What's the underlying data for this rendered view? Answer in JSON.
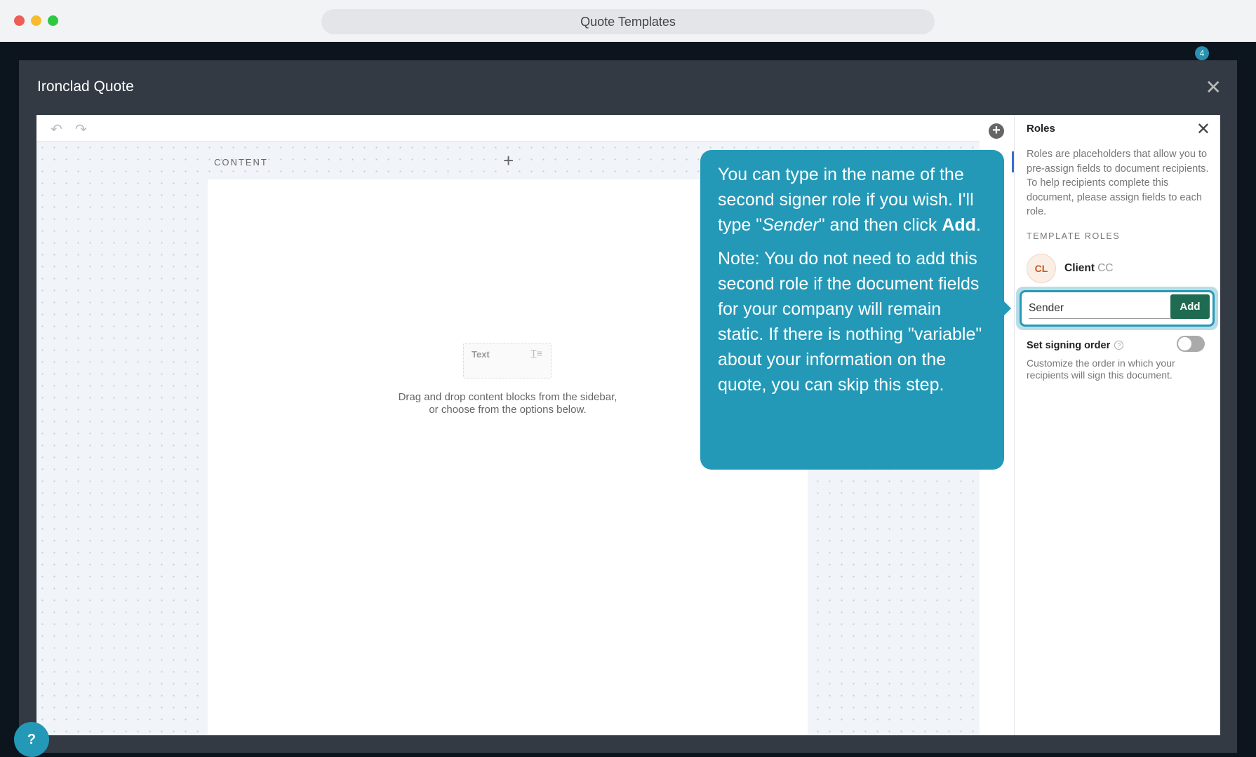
{
  "window": {
    "title": "Quote Templates"
  },
  "app": {
    "notification_count": "4"
  },
  "modal": {
    "title": "Ironclad Quote",
    "close": "✕"
  },
  "editor": {
    "undo": "↶",
    "redo": "↷",
    "content_label": "CONTENT",
    "add": "+",
    "text_block": "Text",
    "text_icon": "T̲≡",
    "hint_line1": "Drag and drop content blocks from the sidebar,",
    "hint_line2": "or choose from the options below."
  },
  "roles_panel": {
    "title": "Roles",
    "close": "✕",
    "description": "Roles are placeholders that allow you to pre-assign fields to document recipients. To help recipients complete this document, please assign fields to each role.",
    "section": "TEMPLATE ROLES",
    "roles": [
      {
        "initials": "CL",
        "name": "Client",
        "type": "CC"
      }
    ],
    "new_role_value": "Sender",
    "add_label": "Add",
    "signing_order_label": "Set signing order",
    "signing_order_enabled": false,
    "signing_order_desc": "Customize the order in which your recipients will sign this document."
  },
  "tooltip": {
    "p1_a": "You can type in the name of the second signer role if you wish. I'll type \"",
    "p1_em": "Sender",
    "p1_b": "\" and then click ",
    "p1_strong": "Add",
    "p1_end": ".",
    "p2": "Note: You do not need to add this second role if the document fields for your company will remain static. If there is nothing \"variable\" about your information on the quote, you can skip this step."
  },
  "help": {
    "label": "?"
  },
  "colors": {
    "accent": "#2399b7",
    "add_button": "#1f6b51",
    "modal_bg": "#333a44"
  }
}
